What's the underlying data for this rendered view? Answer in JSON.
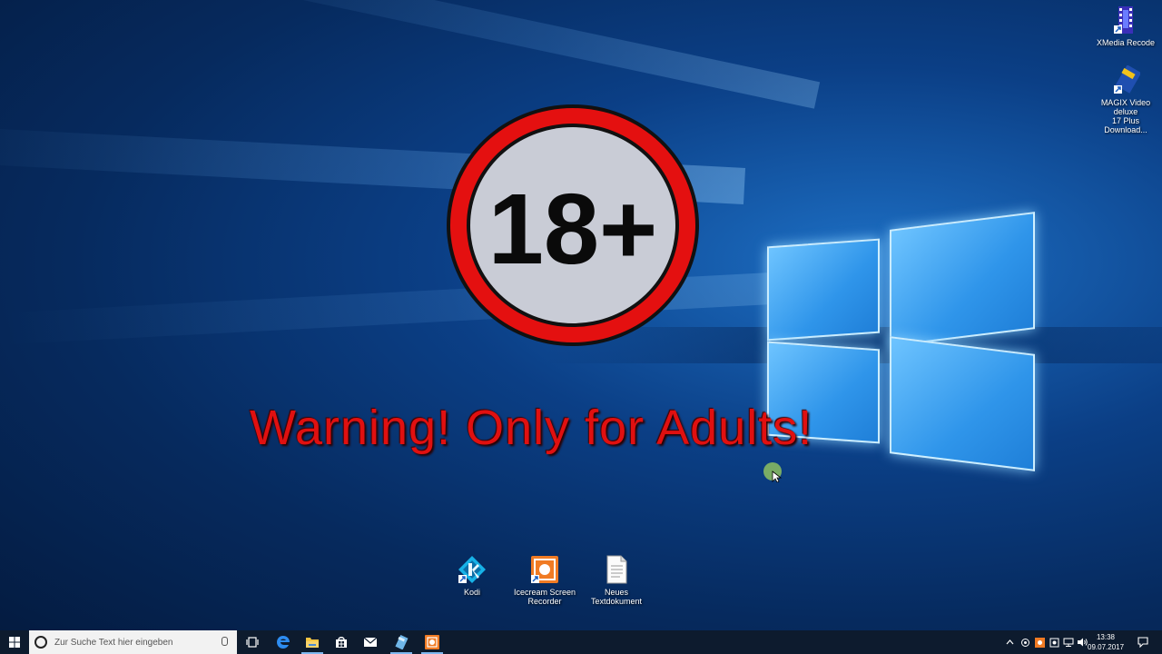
{
  "desktop": {
    "sign_text": "18+",
    "warning_text": "Warning! Only for Adults!",
    "icons_top_right": [
      {
        "label": "XMedia Recode",
        "icon": "xmedia-recode-icon"
      },
      {
        "label_line1": "MAGIX Video deluxe",
        "label_line2": "17 Plus Download...",
        "icon": "magix-video-icon"
      }
    ],
    "icons_bottom": [
      {
        "label": "Kodi",
        "icon": "kodi-icon"
      },
      {
        "label_line1": "Icecream Screen",
        "label_line2": "Recorder",
        "icon": "icecream-recorder-icon"
      },
      {
        "label": "Neues Textdokument",
        "icon": "text-document-icon"
      }
    ]
  },
  "taskbar": {
    "search_placeholder": "Zur Suche Text hier eingeben",
    "clock_time": "13:38",
    "clock_date": "09.07.2017",
    "pinned": [
      "task-view-icon",
      "edge-icon",
      "file-explorer-icon",
      "store-icon",
      "mail-icon",
      "magix-icon",
      "icecream-icon"
    ]
  },
  "colors": {
    "warning_red": "#e01010",
    "sign_red": "#e41010",
    "taskbar_bg": "#0d1b2e",
    "search_bg": "#f2f2f2"
  }
}
